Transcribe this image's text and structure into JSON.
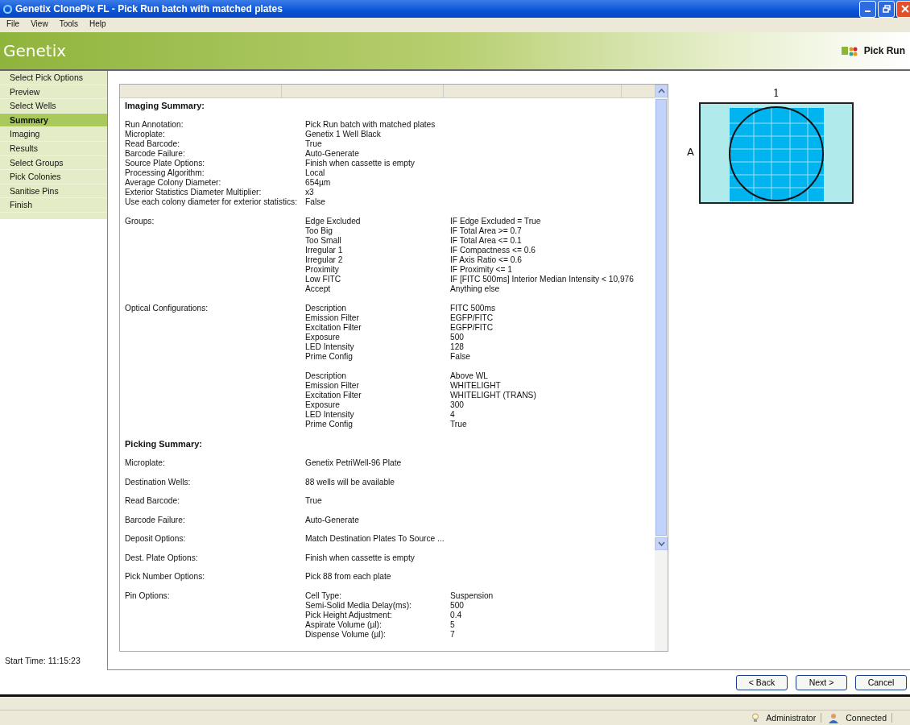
{
  "window": {
    "title": "Genetix ClonePix FL - Pick Run batch with matched plates"
  },
  "menu": [
    "File",
    "View",
    "Tools",
    "Help"
  ],
  "banner": {
    "logo": "Genetix",
    "title": "Pick Run"
  },
  "sidebar": {
    "items": [
      {
        "label": "Select Pick Options",
        "selected": false
      },
      {
        "label": "Preview",
        "selected": false
      },
      {
        "label": "Select Wells",
        "selected": false
      },
      {
        "label": "Summary",
        "selected": true
      },
      {
        "label": "Imaging",
        "selected": false
      },
      {
        "label": "Results",
        "selected": false
      },
      {
        "label": "Select Groups",
        "selected": false
      },
      {
        "label": "Pick Colonies",
        "selected": false
      },
      {
        "label": "Sanitise Pins",
        "selected": false
      },
      {
        "label": "Finish",
        "selected": false
      }
    ],
    "start_time": "Start Time:  11:15:23"
  },
  "summary": {
    "sections": [
      {
        "heading": "Imaging Summary:",
        "kind": "compact",
        "blocks": [
          {
            "rows": [
              {
                "label": "Run Annotation:",
                "value": "Pick Run batch with matched plates"
              },
              {
                "label": "Microplate:",
                "value": "Genetix 1 Well Black"
              },
              {
                "label": "Read Barcode:",
                "value": "True"
              },
              {
                "label": "Barcode Failure:",
                "value": "Auto-Generate"
              },
              {
                "label": "Source Plate Options:",
                "value": "Finish when cassette is empty"
              },
              {
                "label": "Processing Algorithm:",
                "value": "Local"
              },
              {
                "label": "Average Colony Diameter:",
                "value": "654µm"
              },
              {
                "label": "Exterior Statistics Diameter Multiplier:",
                "value": "x3"
              },
              {
                "label": "Use each colony diameter for exterior statistics:",
                "value": "False"
              }
            ]
          },
          {
            "rows": [
              {
                "label": "Groups:",
                "value": "Edge Excluded",
                "detail": "IF Edge Excluded = True"
              },
              {
                "value": "Too Big",
                "detail": "IF Total Area >= 0.7"
              },
              {
                "value": "Too Small",
                "detail": "IF Total Area <= 0.1"
              },
              {
                "value": "Irregular 1",
                "detail": "IF Compactness <= 0.6"
              },
              {
                "value": "Irregular 2",
                "detail": "IF Axis Ratio <= 0.6"
              },
              {
                "value": "Proximity",
                "detail": "IF Proximity <= 1"
              },
              {
                "value": "Low FITC",
                "detail": "IF [FITC 500ms] Interior Median Intensity < 10,976"
              },
              {
                "value": "Accept",
                "detail": "Anything else"
              }
            ]
          },
          {
            "rows": [
              {
                "label": "Optical Configurations:",
                "value": "Description",
                "detail": "FITC 500ms"
              },
              {
                "value": "Emission Filter",
                "detail": "EGFP/FITC"
              },
              {
                "value": "Excitation Filter",
                "detail": "EGFP/FITC"
              },
              {
                "value": "Exposure",
                "detail": "500"
              },
              {
                "value": "LED Intensity",
                "detail": "128"
              },
              {
                "value": "Prime Config",
                "detail": "False"
              }
            ]
          },
          {
            "rows": [
              {
                "value": "Description",
                "detail": "Above WL"
              },
              {
                "value": "Emission Filter",
                "detail": "WHITELIGHT"
              },
              {
                "value": "Excitation Filter",
                "detail": "WHITELIGHT (TRANS)"
              },
              {
                "value": "Exposure",
                "detail": "300"
              },
              {
                "value": "LED Intensity",
                "detail": "4"
              },
              {
                "value": "Prime Config",
                "detail": "True"
              }
            ]
          }
        ]
      },
      {
        "heading": "Picking Summary:",
        "kind": "spaced",
        "blocks": [
          {
            "rows": [
              {
                "label": "Microplate:",
                "value": "Genetix PetriWell-96 Plate"
              }
            ]
          },
          {
            "rows": [
              {
                "label": "Destination Wells:",
                "value": "88 wells will be available"
              }
            ]
          },
          {
            "rows": [
              {
                "label": "Read Barcode:",
                "value": "True"
              }
            ]
          },
          {
            "rows": [
              {
                "label": "Barcode Failure:",
                "value": "Auto-Generate"
              }
            ]
          },
          {
            "rows": [
              {
                "label": "Deposit Options:",
                "value": "Match Destination Plates To Source ..."
              }
            ]
          },
          {
            "rows": [
              {
                "label": "Dest. Plate Options:",
                "value": "Finish when cassette is empty"
              }
            ]
          },
          {
            "rows": [
              {
                "label": "Pick Number Options:",
                "value": "Pick 88 from each plate"
              }
            ]
          },
          {
            "rows": [
              {
                "label": "Pin Options:",
                "value": "Cell Type:",
                "detail": "Suspension"
              },
              {
                "value": "Semi-Solid Media Delay(ms):",
                "detail": "500"
              },
              {
                "value": "Pick Height Adjustment:",
                "detail": "0.4"
              },
              {
                "value": "Aspirate Volume (µl):",
                "detail": "5"
              },
              {
                "value": "Dispense Volume (µl):",
                "detail": "7"
              }
            ]
          }
        ]
      }
    ]
  },
  "plate": {
    "column_label": "1",
    "row_label": "A"
  },
  "buttons": [
    "< Back",
    "Next >",
    "Cancel"
  ],
  "status_bar": {
    "user": "Administrator",
    "connection": "Connected"
  }
}
